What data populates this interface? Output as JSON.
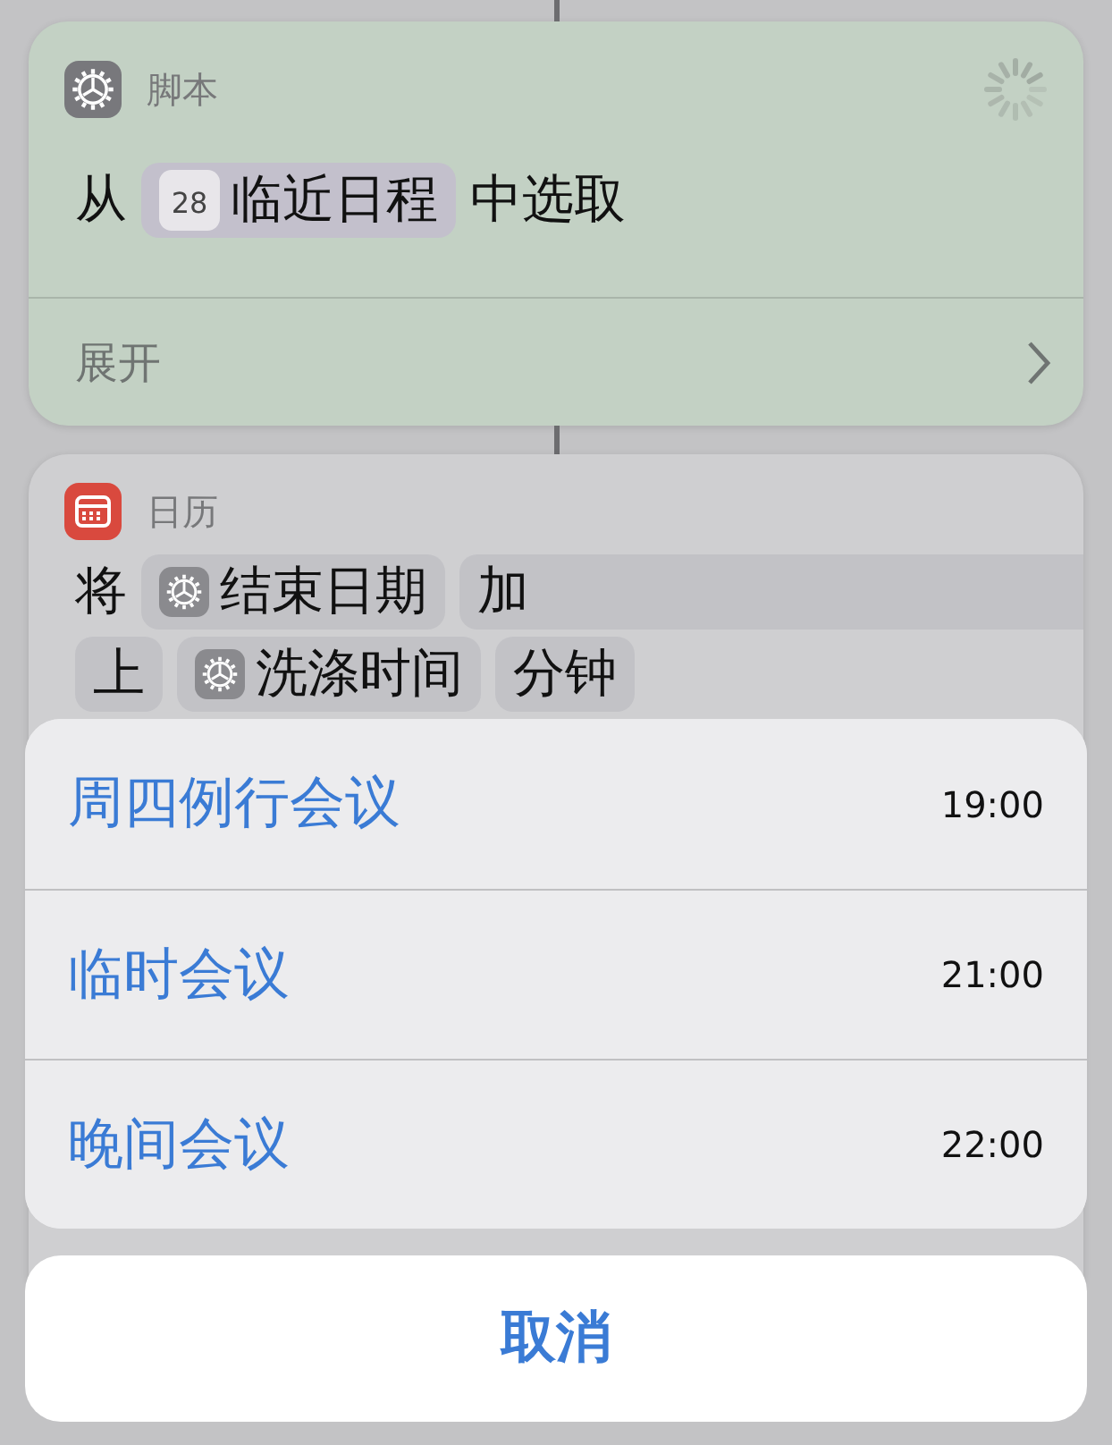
{
  "cards": [
    {
      "app": "脚本",
      "highlighted": true,
      "busy": true,
      "lines": [
        [
          {
            "kind": "text",
            "text": "从"
          },
          {
            "kind": "variable",
            "icon_text": "28",
            "text": "临近日程"
          },
          {
            "kind": "text",
            "text": "中选取"
          }
        ]
      ],
      "footer": "展开"
    },
    {
      "app": "日历",
      "highlighted": false,
      "busy": false,
      "lines": [
        [
          {
            "kind": "text",
            "text": "将"
          },
          {
            "kind": "variable",
            "text": "结束日期"
          },
          {
            "kind": "field",
            "text": "加",
            "wide": true
          }
        ],
        [
          {
            "kind": "field",
            "text": "上",
            "wide": false
          },
          {
            "kind": "variable",
            "text": "洗涤时间"
          },
          {
            "kind": "field",
            "text": "分钟",
            "wide": false
          }
        ]
      ]
    }
  ],
  "sheet": {
    "options": [
      {
        "label": "周四例行会议",
        "time": "19:00"
      },
      {
        "label": "临时会议",
        "time": "21:00"
      },
      {
        "label": "晚间会议",
        "time": "22:00"
      }
    ],
    "cancel": "取消"
  }
}
